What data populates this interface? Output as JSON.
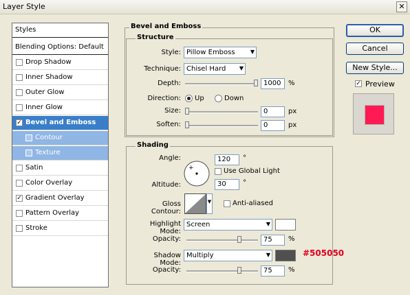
{
  "window": {
    "title": "Layer Style",
    "close_label": "✕"
  },
  "left_panel": {
    "header": "Styles",
    "blending": "Blending Options: Default",
    "items": [
      {
        "label": "Drop Shadow",
        "checked": false
      },
      {
        "label": "Inner Shadow",
        "checked": false
      },
      {
        "label": "Outer Glow",
        "checked": false
      },
      {
        "label": "Inner Glow",
        "checked": false
      },
      {
        "label": "Bevel and Emboss",
        "checked": true
      },
      {
        "label": "Contour",
        "checked": false
      },
      {
        "label": "Texture",
        "checked": false
      },
      {
        "label": "Satin",
        "checked": false
      },
      {
        "label": "Color Overlay",
        "checked": false
      },
      {
        "label": "Gradient Overlay",
        "checked": true
      },
      {
        "label": "Pattern Overlay",
        "checked": false
      },
      {
        "label": "Stroke",
        "checked": false
      }
    ],
    "check_mark": "✓"
  },
  "main": {
    "section_title": "Bevel and Emboss",
    "structure": {
      "title": "Structure",
      "style_label": "Style:",
      "style_value": "Pillow Emboss",
      "technique_label": "Technique:",
      "technique_value": "Chisel Hard",
      "depth_label": "Depth:",
      "depth_value": "1000",
      "depth_unit": "%",
      "depth_fraction": 1.0,
      "direction_label": "Direction:",
      "up_label": "Up",
      "down_label": "Down",
      "direction_selected": "Up",
      "size_label": "Size:",
      "size_value": "0",
      "size_unit": "px",
      "size_fraction": 0.0,
      "soften_label": "Soften:",
      "soften_value": "0",
      "soften_unit": "px",
      "soften_fraction": 0.0
    },
    "shading": {
      "title": "Shading",
      "angle_label": "Angle:",
      "angle_value": "120",
      "angle_unit": "°",
      "global_light_label": "Use Global Light",
      "global_light_checked": false,
      "altitude_label": "Altitude:",
      "altitude_value": "30",
      "altitude_unit": "°",
      "gloss_contour_label": "Gloss Contour:",
      "anti_aliased_label": "Anti-aliased",
      "anti_aliased_checked": false,
      "highlight_mode_label": "Highlight Mode:",
      "highlight_mode_value": "Screen",
      "highlight_color": "#ffffff",
      "highlight_opacity_label": "Opacity:",
      "highlight_opacity_value": "75",
      "highlight_opacity_unit": "%",
      "highlight_opacity_fraction": 0.75,
      "shadow_mode_label": "Shadow Mode:",
      "shadow_mode_value": "Multiply",
      "shadow_color": "#505050",
      "shadow_color_annotation": "#505050",
      "shadow_opacity_label": "Opacity:",
      "shadow_opacity_value": "75",
      "shadow_opacity_unit": "%",
      "shadow_opacity_fraction": 0.75
    }
  },
  "right_panel": {
    "ok_label": "OK",
    "cancel_label": "Cancel",
    "new_style_label": "New Style...",
    "preview_label": "Preview",
    "preview_checked": true,
    "preview_color": "#ff1a55"
  },
  "arrow_glyph": "▼"
}
